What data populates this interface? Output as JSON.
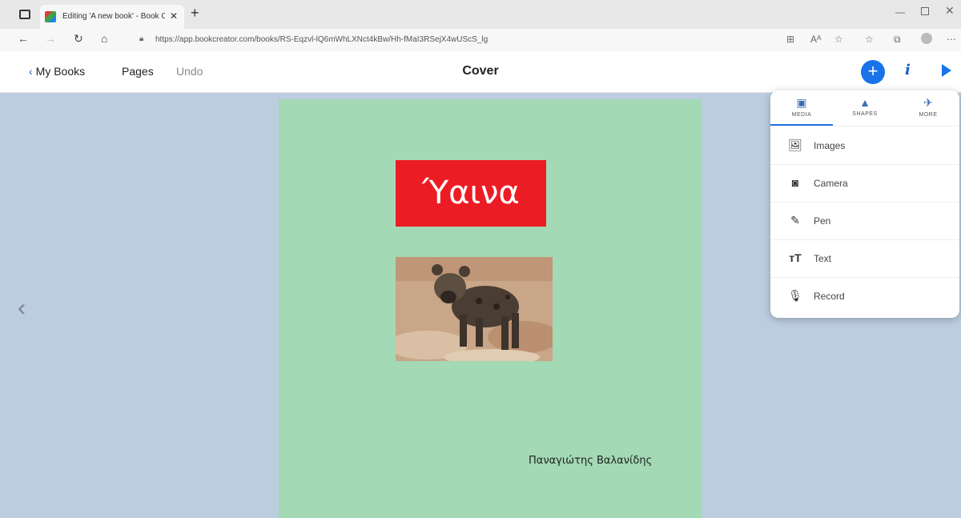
{
  "browser": {
    "tab_title": "Editing 'A new book' - Book Cre",
    "url": "https://app.bookcreator.com/books/RS-Eqzvl-lQ6mWhLXNct4kBw/Hh-fMaI3RSejX4wUScS_lg"
  },
  "header": {
    "back_label": "My Books",
    "pages_label": "Pages",
    "undo_label": "Undo",
    "title": "Cover",
    "add_label": "+",
    "info_label": "i"
  },
  "book": {
    "title": "Ύαινα",
    "author": "Παναγιώτης Βαλανίδης",
    "background_color": "#a3d9b4",
    "title_color": "#ec1c24"
  },
  "panel": {
    "tabs": [
      {
        "label": "MEDIA",
        "icon": "media-icon"
      },
      {
        "label": "SHAPES",
        "icon": "shapes-icon"
      },
      {
        "label": "MORE",
        "icon": "more-icon"
      }
    ],
    "active_tab": "MEDIA",
    "items": [
      {
        "label": "Images",
        "icon": "images-icon"
      },
      {
        "label": "Camera",
        "icon": "camera-icon"
      },
      {
        "label": "Pen",
        "icon": "pen-icon"
      },
      {
        "label": "Text",
        "icon": "text-icon"
      },
      {
        "label": "Record",
        "icon": "microphone-icon"
      }
    ]
  },
  "colors": {
    "accent": "#1a73e8",
    "canvas": "#bccde0"
  }
}
